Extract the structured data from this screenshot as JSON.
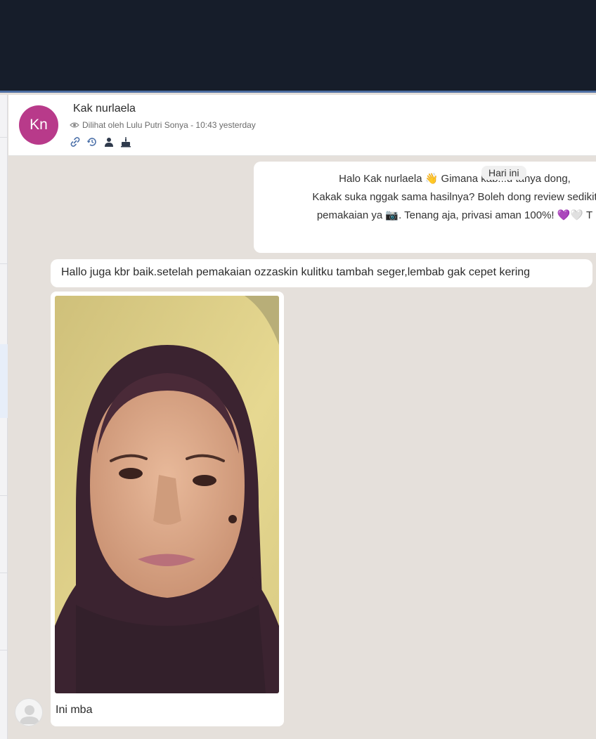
{
  "colors": {
    "topbar": "#161d2a",
    "topbar_border": "#4e6fa3",
    "chat_background": "#e5e0db",
    "avatar": "#b83a8a",
    "bubble": "#ffffff"
  },
  "header": {
    "avatar_initials": "Kn",
    "contact_name": "Kak nurlaela",
    "seen_icon": "eye-icon",
    "seen_text": "Dilihat oleh Lulu Putri Sonya - 10:43 yesterday",
    "actions": [
      {
        "name": "link-icon"
      },
      {
        "name": "history-icon"
      },
      {
        "name": "person-icon"
      },
      {
        "name": "cake-icon"
      }
    ]
  },
  "date_chip": "Hari ini",
  "messages": {
    "outgoing_text": "Halo Kak nurlaela 👋 Gimana kab...u tanya dong,\nKakak suka nggak sama hasilnya? Boleh dong review sedikit\npemakaian ya 📷. Tenang aja, privasi aman 100%! 💜🤍 T",
    "incoming_text": "Hallo juga kbr baik.setelah pemakaian ozzaskin kulitku tambah seger,lembab gak cepet kering",
    "photo_caption": "Ini mba"
  }
}
